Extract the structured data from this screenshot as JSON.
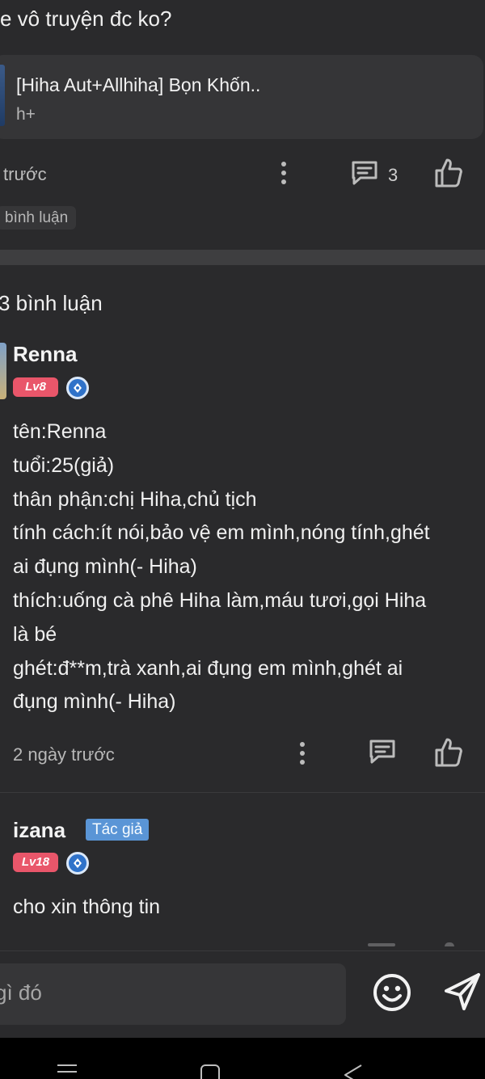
{
  "post": {
    "title_partial": "e vô truyện đc ko?",
    "story": {
      "name": "[Hiha Aut+Allhiha] Bọn Khốn..",
      "tag": "h+"
    },
    "time_partial": "trước",
    "comment_count": "3",
    "chip_label": "bình luận"
  },
  "comments_section": {
    "heading": "3 bình luận",
    "comments": [
      {
        "username": "Renna",
        "level": "Lv8",
        "lines": [
          "tên:Renna",
          "tuổi:25(giả)",
          "thân phận:chị Hiha,chủ tịch",
          "tính cách:ít nói,bảo vệ em mình,nóng tính,ghét",
          "ai đụng mình(- Hiha)",
          "thích:uống cà phê Hiha làm,máu tươi,gọi Hiha",
          "là bé",
          "ghét:đ**m,trà xanh,ai đụng em mình,ghét ai",
          "đụng mình(- Hiha)"
        ],
        "time": "2 ngày trước"
      },
      {
        "username": "izana",
        "badge": "Tác giả",
        "level": "Lv18",
        "lines": [
          "cho xin thông tin"
        ]
      }
    ]
  },
  "composer": {
    "placeholder": "gì đó"
  },
  "icons": {
    "more": "more-vertical-icon",
    "comment": "comment-icon",
    "like": "thumbs-up-icon",
    "verify": "verified-badge-icon",
    "emoji": "smiley-icon",
    "send": "send-icon",
    "nav_menu": "menu-icon",
    "nav_home": "home-icon",
    "nav_back": "back-icon"
  },
  "colors": {
    "background": "#2a2a2c",
    "level_badge": "#e9566a",
    "author_badge": "#5a95d6",
    "verify_badge": "#2f72c9"
  }
}
